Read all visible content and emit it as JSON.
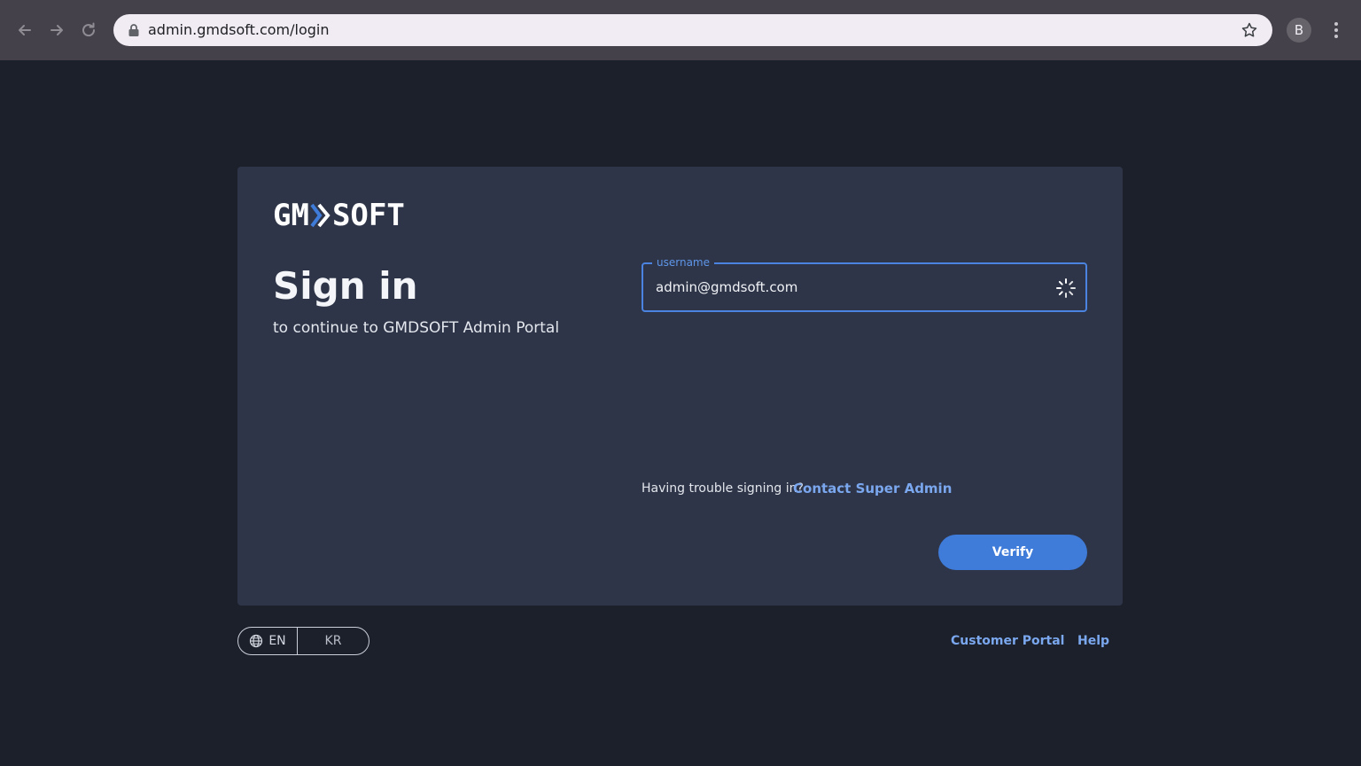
{
  "browser": {
    "url": "admin.gmdsoft.com/login",
    "profile_initial": "B"
  },
  "brand": {
    "logo_left": "GM",
    "logo_right": "SOFT",
    "accent_color": "#3f7bd9"
  },
  "signin": {
    "title": "Sign in",
    "subtitle": "to continue to GMDSOFT Admin Portal",
    "username_label": "username",
    "username_value": "admin@gmdsoft.com",
    "trouble_text": "Having trouble signing in?",
    "contact_link": "Contact Super Admin",
    "verify_label": "Verify"
  },
  "footer": {
    "lang_en": "EN",
    "lang_kr": "KR",
    "customer_portal": "Customer Portal",
    "help": "Help"
  },
  "icons": {
    "back": "arrow-left-icon",
    "forward": "arrow-right-icon",
    "reload": "reload-icon",
    "lock": "lock-icon",
    "star": "star-icon",
    "menu": "kebab-menu-icon",
    "spinner": "loading-spinner-icon",
    "globe": "globe-icon"
  }
}
